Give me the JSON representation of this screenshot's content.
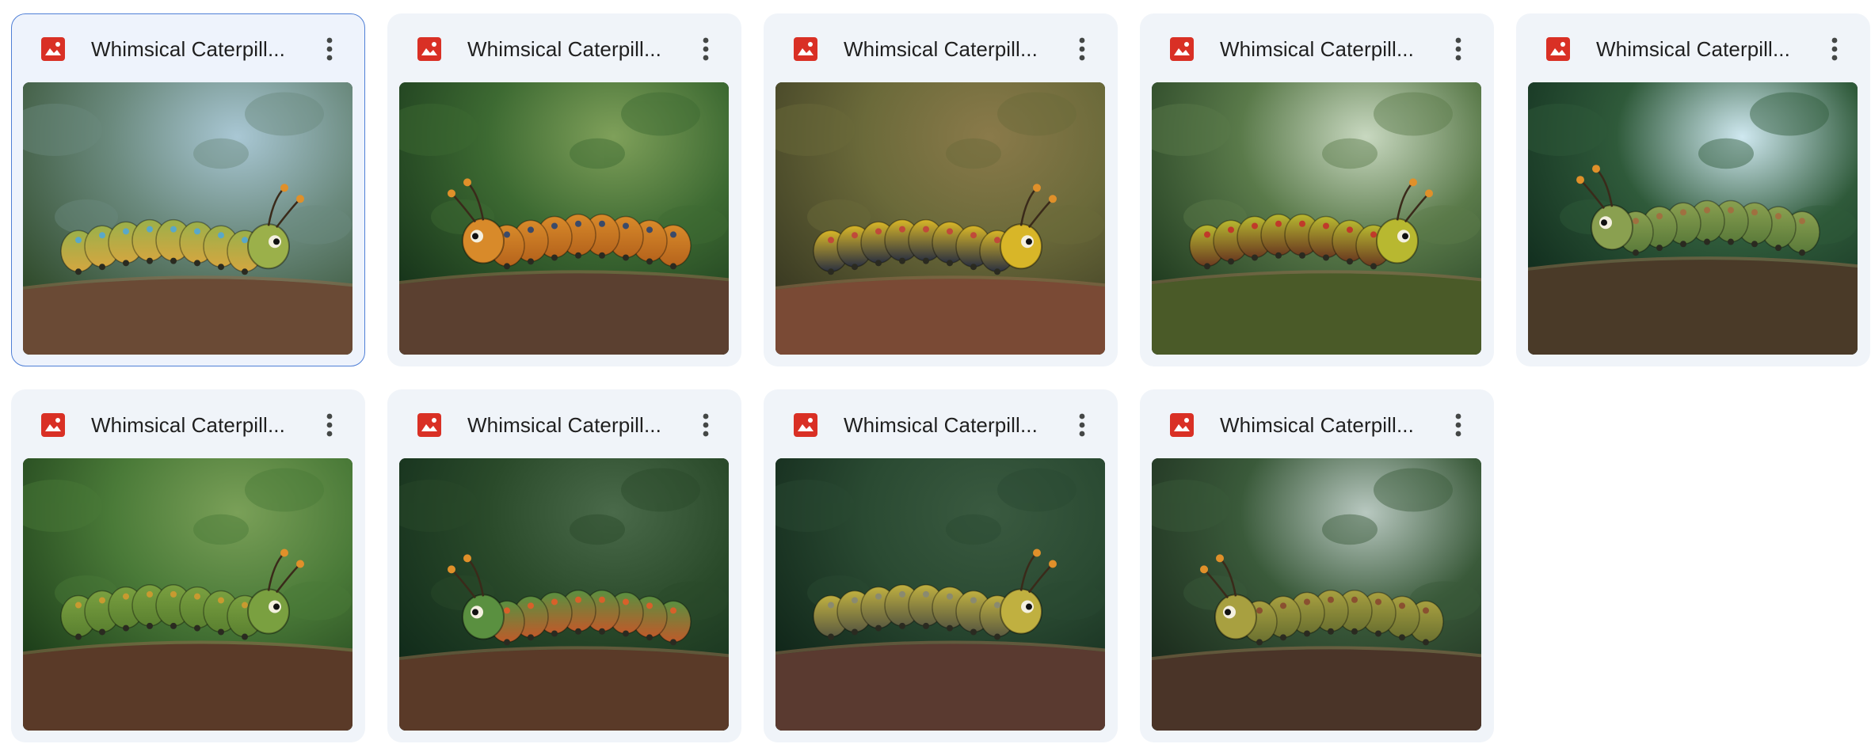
{
  "files": [
    {
      "title": "Whimsical Caterpill...",
      "icon": "image-file-icon",
      "more_icon": "more-vert-icon",
      "selected": true,
      "scene": {
        "bg1": "#2f4a2a",
        "bg2": "#6b8a7e",
        "light": "#a9c7d4",
        "branch": "#6a4a35",
        "body": "#9bb04a",
        "stripe": "#d4a640",
        "spots": "#5aa8c8",
        "dir": 1,
        "y": 0.62
      }
    },
    {
      "title": "Whimsical Caterpill...",
      "icon": "image-file-icon",
      "more_icon": "more-vert-icon",
      "selected": false,
      "scene": {
        "bg1": "#16331a",
        "bg2": "#3d6a32",
        "light": "#7fa05a",
        "branch": "#5b4030",
        "body": "#d88a2a",
        "stripe": "#b5631c",
        "spots": "#3a4a6a",
        "dir": -1,
        "y": 0.6
      }
    },
    {
      "title": "Whimsical Caterpill...",
      "icon": "image-file-icon",
      "more_icon": "more-vert-icon",
      "selected": false,
      "scene": {
        "bg1": "#3a3a22",
        "bg2": "#6b6a3a",
        "light": "#8a7a4a",
        "branch": "#7a4a35",
        "body": "#d8b628",
        "stripe": "#2a3040",
        "spots": "#c04a3a",
        "dir": 1,
        "y": 0.62
      }
    },
    {
      "title": "Whimsical Caterpill...",
      "icon": "image-file-icon",
      "more_icon": "more-vert-icon",
      "selected": false,
      "scene": {
        "bg1": "#1f3a1f",
        "bg2": "#5a7a4a",
        "light": "#c8d8c0",
        "branch": "#4a5a28",
        "body": "#b8b830",
        "stripe": "#6a3a20",
        "spots": "#c03a2a",
        "dir": 1,
        "y": 0.6
      }
    },
    {
      "title": "Whimsical Caterpill...",
      "icon": "image-file-icon",
      "more_icon": "more-vert-icon",
      "selected": false,
      "scene": {
        "bg1": "#0f2a1c",
        "bg2": "#2f5a3a",
        "light": "#cfe8f0",
        "branch": "#4a3a28",
        "body": "#8aa050",
        "stripe": "#5a7a3a",
        "spots": "#a07040",
        "dir": -1,
        "y": 0.55
      }
    },
    {
      "title": "Whimsical Caterpill...",
      "icon": "image-file-icon",
      "more_icon": "more-vert-icon",
      "selected": false,
      "scene": {
        "bg1": "#1a3a18",
        "bg2": "#4a7a38",
        "light": "#7aa058",
        "branch": "#5a3a28",
        "body": "#7aa040",
        "stripe": "#5a8030",
        "spots": "#c89a30",
        "dir": 1,
        "y": 0.58
      }
    },
    {
      "title": "Whimsical Caterpill...",
      "icon": "image-file-icon",
      "more_icon": "more-vert-icon",
      "selected": false,
      "scene": {
        "bg1": "#102a1a",
        "bg2": "#2a4a2a",
        "light": "#4a6a4a",
        "branch": "#5a3a28",
        "body": "#5a9040",
        "stripe": "#c05a2a",
        "spots": "#d8602a",
        "dir": -1,
        "y": 0.6
      }
    },
    {
      "title": "Whimsical Caterpill...",
      "icon": "image-file-icon",
      "more_icon": "more-vert-icon",
      "selected": false,
      "scene": {
        "bg1": "#0f2418",
        "bg2": "#2a4a32",
        "light": "#3a5a40",
        "branch": "#5a3a30",
        "body": "#c0b040",
        "stripe": "#5a5a40",
        "spots": "#8a8a70",
        "dir": 1,
        "y": 0.58
      }
    },
    {
      "title": "Whimsical Caterpill...",
      "icon": "image-file-icon",
      "more_icon": "more-vert-icon",
      "selected": false,
      "scene": {
        "bg1": "#1a2a1c",
        "bg2": "#3a5a3a",
        "light": "#b8c8c0",
        "branch": "#4a3428",
        "body": "#a8a040",
        "stripe": "#6a7030",
        "spots": "#8a5030",
        "dir": -1,
        "y": 0.6
      }
    }
  ],
  "colors": {
    "card_bg": "#f0f4f9",
    "selected_border": "#4f7fd6",
    "icon_red": "#d93025",
    "title_text": "#1f1f1f",
    "more_icon": "#444746"
  }
}
